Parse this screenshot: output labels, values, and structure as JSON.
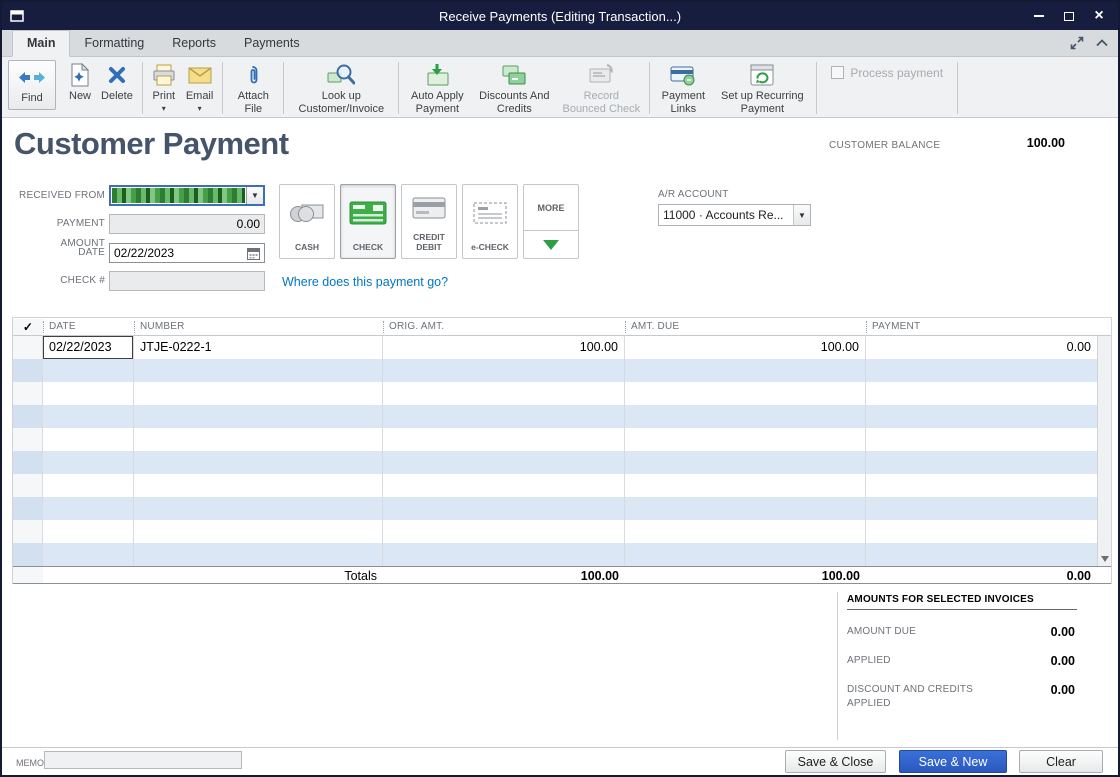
{
  "titlebar": {
    "title": "Receive Payments (Editing Transaction...)"
  },
  "tabs": {
    "main": "Main",
    "formatting": "Formatting",
    "reports": "Reports",
    "payments": "Payments"
  },
  "toolbar": {
    "find": "Find",
    "new": "New",
    "delete": "Delete",
    "print": "Print",
    "email": "Email",
    "attach_file": "Attach File",
    "look_up": "Look up Customer/Invoice",
    "auto_apply": "Auto Apply Payment",
    "discounts": "Discounts And Credits",
    "record_bounced": "Record Bounced Check",
    "payment_links": "Payment Links",
    "recurring": "Set up Recurring Payment",
    "process_payment": "Process payment"
  },
  "header": {
    "title": "Customer Payment",
    "balance_label": "CUSTOMER BALANCE",
    "balance_value": "100.00"
  },
  "form": {
    "received_from_label": "RECEIVED FROM",
    "payment_amount_label": "PAYMENT AMOUNT",
    "payment_amount_value": "0.00",
    "date_label": "DATE",
    "date_value": "02/22/2023",
    "check_number_label": "CHECK #",
    "check_number_value": "",
    "where_link": "Where does this payment go?",
    "ar_account_label": "A/R ACCOUNT",
    "ar_account_value": "11000 · Accounts Re..."
  },
  "payment_methods": {
    "cash": "CASH",
    "check": "CHECK",
    "credit_line1": "CREDIT",
    "credit_line2": "DEBIT",
    "echeck": "e-CHECK",
    "more": "MORE"
  },
  "table": {
    "headers": {
      "check": "✓",
      "date": "DATE",
      "number": "NUMBER",
      "orig_amt": "ORIG. AMT.",
      "amt_due": "AMT. DUE",
      "payment": "PAYMENT"
    },
    "row": {
      "date": "02/22/2023",
      "number": "JTJE-0222-1",
      "orig_amt": "100.00",
      "amt_due": "100.00",
      "payment": "0.00"
    },
    "totals": {
      "label": "Totals",
      "orig_amt": "100.00",
      "amt_due": "100.00",
      "payment": "0.00"
    }
  },
  "summary": {
    "title": "AMOUNTS FOR SELECTED INVOICES",
    "amount_due_label": "AMOUNT DUE",
    "amount_due_value": "0.00",
    "applied_label": "APPLIED",
    "applied_value": "0.00",
    "discount_label": "DISCOUNT AND CREDITS APPLIED",
    "discount_value": "0.00"
  },
  "footer": {
    "memo_label": "MEMO",
    "memo_value": "",
    "save_close": "Save & Close",
    "save_new": "Save & New",
    "clear": "Clear"
  }
}
